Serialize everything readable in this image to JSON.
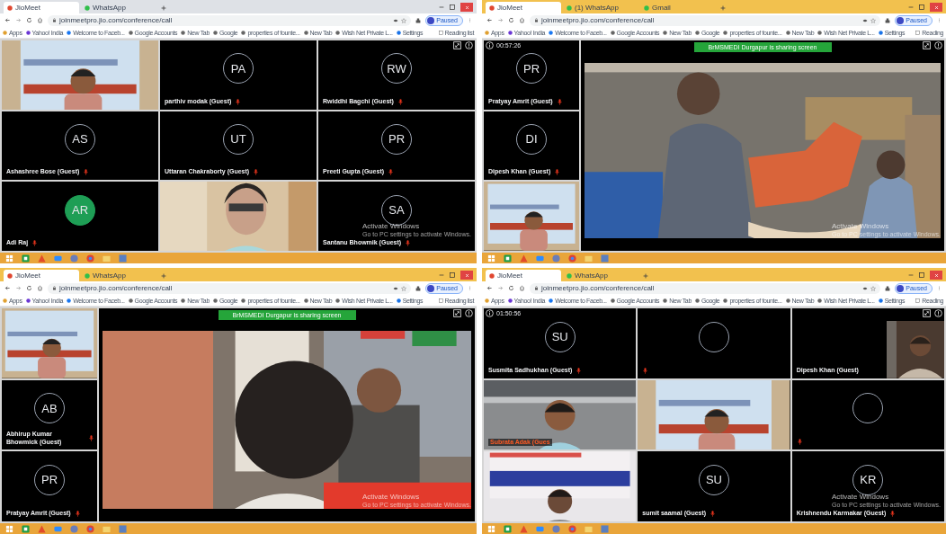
{
  "screens": [
    {
      "tabs": [
        {
          "label": "JioMeet",
          "selected": true
        },
        {
          "label": "WhatsApp",
          "selected": false
        }
      ],
      "url": "joinmeetpro.jio.com/conference/call",
      "profile": "Paused",
      "bookmarks": [
        "Apps",
        "Yahoo! India",
        "Welcome to Faceb...",
        "Google Accounts",
        "New Tab",
        "Google",
        "properties of founte...",
        "New Tab",
        "Wish Net Private L...",
        "Settings"
      ],
      "reading_list": "Reading list",
      "meeting": {
        "tiles": [
          {
            "kind": "video"
          },
          {
            "kind": "avatar",
            "initials": "PA",
            "name": "parthiv modak (Guest)",
            "muted": true
          },
          {
            "kind": "avatar",
            "initials": "RW",
            "name": "Rwiddhi Bagchi (Guest)",
            "muted": true
          },
          {
            "kind": "avatar",
            "initials": "AS",
            "name": "Ashashree Bose (Guest)",
            "muted": true
          },
          {
            "kind": "avatar",
            "initials": "UT",
            "name": "Uttaran Chakraborty (Guest)",
            "muted": true
          },
          {
            "kind": "avatar",
            "initials": "PR",
            "name": "Preeti Gupta (Guest)",
            "muted": true
          },
          {
            "kind": "avatar",
            "initials": "AR",
            "name": "Adi Raj",
            "muted": true,
            "color": "#1e9e55"
          },
          {
            "kind": "video"
          },
          {
            "kind": "avatar",
            "initials": "SA",
            "name": "Santanu Bhowmik (Guest)",
            "muted": true
          }
        ]
      },
      "watermark": {
        "title": "Activate Windows",
        "subtitle": "Go to PC settings to activate Windows."
      }
    },
    {
      "tabs": [
        {
          "label": "JioMeet",
          "selected": true
        },
        {
          "label": "(1) WhatsApp",
          "selected": false
        },
        {
          "label": "Gmail",
          "selected": false
        }
      ],
      "url": "joinmeetpro.jio.com/conference/call",
      "profile": "Paused",
      "bookmarks": [
        "Apps",
        "Yahoo! India",
        "Welcome to Faceb...",
        "Google Accounts",
        "New Tab",
        "Google",
        "properties of founte...",
        "New Tab",
        "Wish Net Private L...",
        "Settings"
      ],
      "reading_list": "Reading",
      "meeting": {
        "timer": "00:57:26",
        "share_banner": "BrMSMEDI Durgapur is sharing screen",
        "tiles": [
          {
            "kind": "avatar",
            "initials": "PR",
            "name": "Pratyay Amrit (Guest)",
            "muted": true
          },
          {
            "kind": "avatar",
            "initials": "DI",
            "name": "Dipesh Khan (Guest)",
            "muted": true
          },
          {
            "kind": "video"
          }
        ]
      },
      "watermark": {
        "title": "Activate Windows",
        "subtitle": "Go to PC settings to activate Windows."
      }
    },
    {
      "tabs": [
        {
          "label": "JioMeet",
          "selected": true
        },
        {
          "label": "WhatsApp",
          "selected": false
        }
      ],
      "url": "joinmeetpro.jio.com/conference/call",
      "profile": "Paused",
      "bookmarks": [
        "Apps",
        "Yahoo! India",
        "Welcome to Faceb...",
        "Google Accounts",
        "New Tab",
        "Google",
        "properties of founte...",
        "New Tab",
        "Wish Net Private L...",
        "Settings"
      ],
      "reading_list": "Reading list",
      "meeting": {
        "share_banner": "BrMSMEDI Durgapur is sharing screen",
        "tiles": [
          {
            "kind": "video"
          },
          {
            "kind": "avatar",
            "initials": "AB",
            "name": "Abhirup Kumar Bhowmick (Guest)",
            "muted": true
          },
          {
            "kind": "avatar",
            "initials": "PR",
            "name": "Pratyay Amrit (Guest)",
            "muted": true
          }
        ]
      },
      "watermark": {
        "title": "Activate Windows",
        "subtitle": "Go to PC settings to activate Windows."
      }
    },
    {
      "tabs": [
        {
          "label": "JioMeet",
          "selected": true
        },
        {
          "label": "WhatsApp",
          "selected": false
        }
      ],
      "url": "joinmeetpro.jio.com/conference/call",
      "profile": "Paused",
      "bookmarks": [
        "Apps",
        "Yahoo! India",
        "Welcome to Faceb...",
        "Google Accounts",
        "New Tab",
        "Google",
        "properties of founte...",
        "New Tab",
        "Wish Net Private L...",
        "Settings"
      ],
      "reading_list": "Reading",
      "meeting": {
        "timer": "01:50:56",
        "tiles": [
          {
            "kind": "avatar",
            "initials": "SU",
            "name": "Susmita Sadhukhan (Guest)",
            "muted": true
          },
          {
            "kind": "blank",
            "muted": true
          },
          {
            "kind": "inset",
            "name": "Dipesh Khan (Guest)"
          },
          {
            "kind": "video",
            "name": "Subrata Adak (Gues"
          },
          {
            "kind": "video"
          },
          {
            "kind": "blank",
            "muted": true
          },
          {
            "kind": "video"
          },
          {
            "kind": "avatar",
            "initials": "SU",
            "name": "sumit saamal (Guest)",
            "muted": true
          },
          {
            "kind": "avatar",
            "initials": "KR",
            "name": "Krishnendu Karmakar (Guest)",
            "muted": true
          }
        ]
      },
      "watermark": {
        "title": "Activate Windows",
        "subtitle": "Go to PC settings to activate Windows."
      }
    }
  ]
}
